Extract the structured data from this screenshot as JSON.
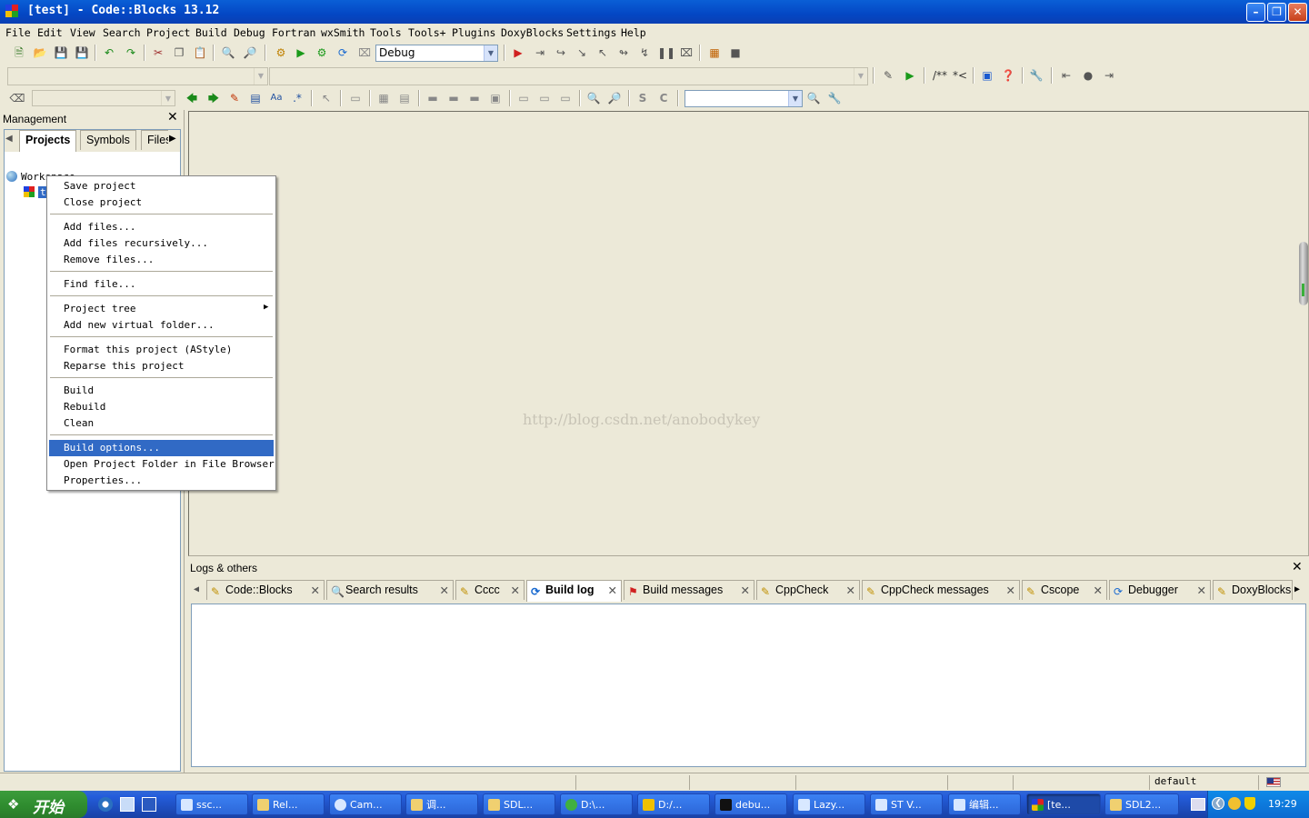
{
  "window": {
    "title": "[test] - Code::Blocks 13.12"
  },
  "menu": [
    "File",
    "Edit",
    "View",
    "Search",
    "Project",
    "Build",
    "Debug",
    "Fortran",
    "wxSmith",
    "Tools",
    "Tools+",
    "Plugins",
    "DoxyBlocks",
    "Settings",
    "Help"
  ],
  "toolbar": {
    "build_target": "Debug",
    "search_text": ""
  },
  "management": {
    "title": "Management",
    "tabs": [
      "Projects",
      "Symbols",
      "Files"
    ],
    "active_tab": "Projects",
    "tree": {
      "workspace": "Workspace",
      "project": "test"
    }
  },
  "context_menu": {
    "items": [
      {
        "label": "Save project"
      },
      {
        "label": "Close project"
      },
      {
        "label": "Add files..."
      },
      {
        "label": "Add files recursively..."
      },
      {
        "label": "Remove files..."
      },
      {
        "label": "Find file..."
      },
      {
        "label": "Project tree",
        "submenu": true
      },
      {
        "label": "Add new virtual folder..."
      },
      {
        "label": "Format this project (AStyle)"
      },
      {
        "label": "Reparse this project"
      },
      {
        "label": "Build"
      },
      {
        "label": "Rebuild"
      },
      {
        "label": "Clean"
      },
      {
        "label": "Build options...",
        "selected": true
      },
      {
        "label": "Open Project Folder in File Browser"
      },
      {
        "label": "Properties..."
      }
    ]
  },
  "editor": {
    "watermark": "http://blog.csdn.net/anobodykey"
  },
  "logs": {
    "title": "Logs & others",
    "tabs": [
      "Code::Blocks",
      "Search results",
      "Cccc",
      "Build log",
      "Build messages",
      "CppCheck",
      "CppCheck messages",
      "Cscope",
      "Debugger",
      "DoxyBlocks"
    ],
    "active_tab": "Build log"
  },
  "statusbar": {
    "mode": "default"
  },
  "taskbar": {
    "start_label": "开始",
    "tasks": [
      "ssc...",
      "Rel...",
      "Cam...",
      "调...",
      "SDL...",
      "D:\\...",
      "D:/...",
      "debu...",
      "Lazy...",
      "ST V...",
      "编辑...",
      "[te...",
      "SDL2..."
    ],
    "active_task": "[te...",
    "clock": "19:29"
  },
  "colors": {
    "titlebar": "#0a5fd6",
    "selection": "#316ac5",
    "face": "#ece9d8",
    "taskbar": "#245ddb"
  }
}
